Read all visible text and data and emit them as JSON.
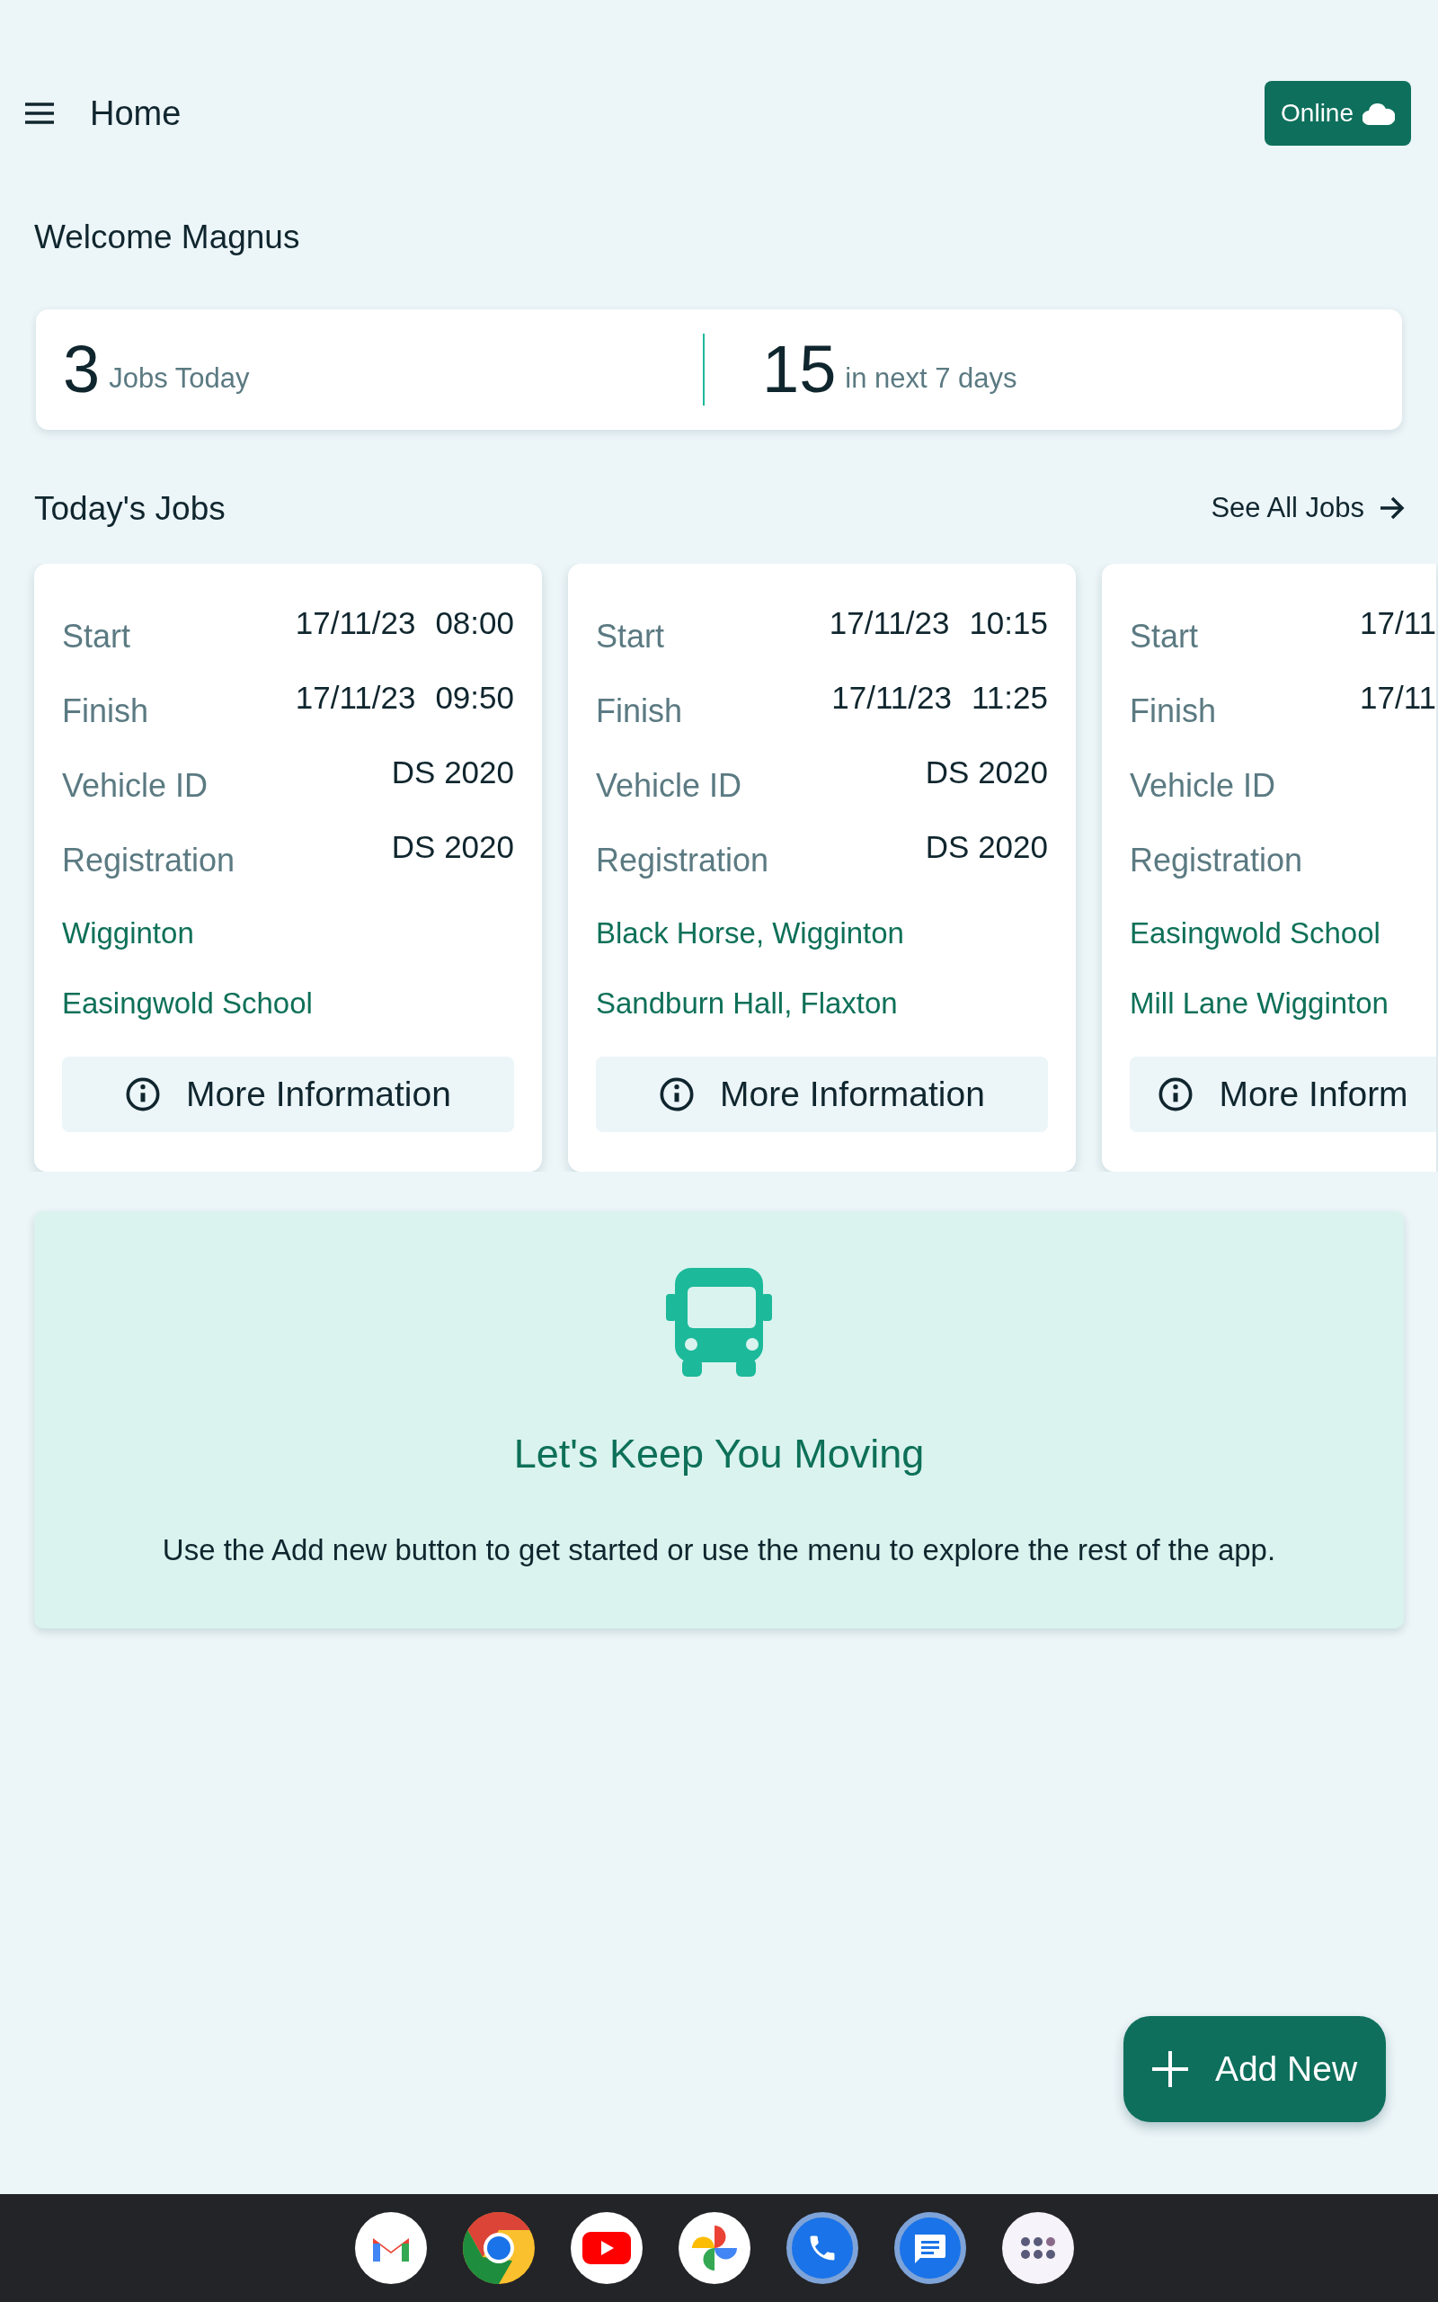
{
  "header": {
    "title": "Home",
    "status_button": "Online"
  },
  "welcome": "Welcome Magnus",
  "stats": [
    {
      "value": "3",
      "label": "Jobs Today"
    },
    {
      "value": "15",
      "label": "in next 7 days"
    }
  ],
  "jobs_section": {
    "title": "Today's Jobs",
    "see_all": "See All Jobs"
  },
  "jobs": [
    {
      "rows": [
        {
          "label": "Start",
          "values": [
            "17/11/23",
            "08:00"
          ]
        },
        {
          "label": "Finish",
          "values": [
            "17/11/23",
            "09:50"
          ]
        },
        {
          "label": "Vehicle ID",
          "values": [
            "DS 2020"
          ]
        },
        {
          "label": "Registration",
          "values": [
            "DS 2020"
          ]
        }
      ],
      "locations": [
        "Wigginton",
        "Easingwold School"
      ],
      "button": "More Information"
    },
    {
      "rows": [
        {
          "label": "Start",
          "values": [
            "17/11/23",
            "10:15"
          ]
        },
        {
          "label": "Finish",
          "values": [
            "17/11/23",
            "11:25"
          ]
        },
        {
          "label": "Vehicle ID",
          "values": [
            "DS 2020"
          ]
        },
        {
          "label": "Registration",
          "values": [
            "DS 2020"
          ]
        }
      ],
      "locations": [
        "Black Horse, Wigginton",
        "Sandburn Hall, Flaxton"
      ],
      "button": "More Information"
    },
    {
      "rows": [
        {
          "label": "Start",
          "values": [
            "17/11"
          ]
        },
        {
          "label": "Finish",
          "values": [
            "17/11"
          ]
        },
        {
          "label": "Vehicle ID",
          "values": []
        },
        {
          "label": "Registration",
          "values": []
        }
      ],
      "locations": [
        "Easingwold School",
        "Mill Lane Wigginton"
      ],
      "button": "More Inform"
    }
  ],
  "promo": {
    "title": "Let's Keep You Moving",
    "text": "Use the Add new button to get started or use the menu to explore the rest of the app."
  },
  "fab": "Add New"
}
